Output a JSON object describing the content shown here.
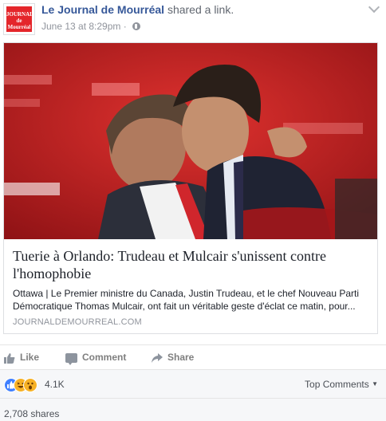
{
  "post": {
    "author": "Le Journal de Mourréal",
    "action": "shared a",
    "action_link": "link.",
    "timestamp": "June 13 at 8:29pm",
    "separator": "·",
    "logo_text": [
      "JOURNAL",
      "de",
      "Mourréal"
    ]
  },
  "link_card": {
    "title": "Tuerie à Orlando: Trudeau et Mulcair s'unissent contre l'homophobie",
    "description": "Ottawa | Le Premier ministre du Canada, Justin Trudeau, et le chef Nouveau Parti Démocratique Thomas Mulcair, ont fait un véritable geste d'éclat ce matin, pour...",
    "domain": "JOURNALDEMOURREAL.COM"
  },
  "actions": {
    "like": "Like",
    "comment": "Comment",
    "share": "Share"
  },
  "reactions": {
    "types": [
      "like-icon",
      "haha-icon",
      "wow-icon"
    ],
    "count": "4.1K",
    "top_comments": "Top Comments"
  },
  "shares": {
    "label": "2,708 shares"
  },
  "colors": {
    "link_blue": "#365899",
    "brand_red": "#e4262b",
    "like_blue": "#4080ff",
    "emoji_yellow": "#f7b125"
  }
}
